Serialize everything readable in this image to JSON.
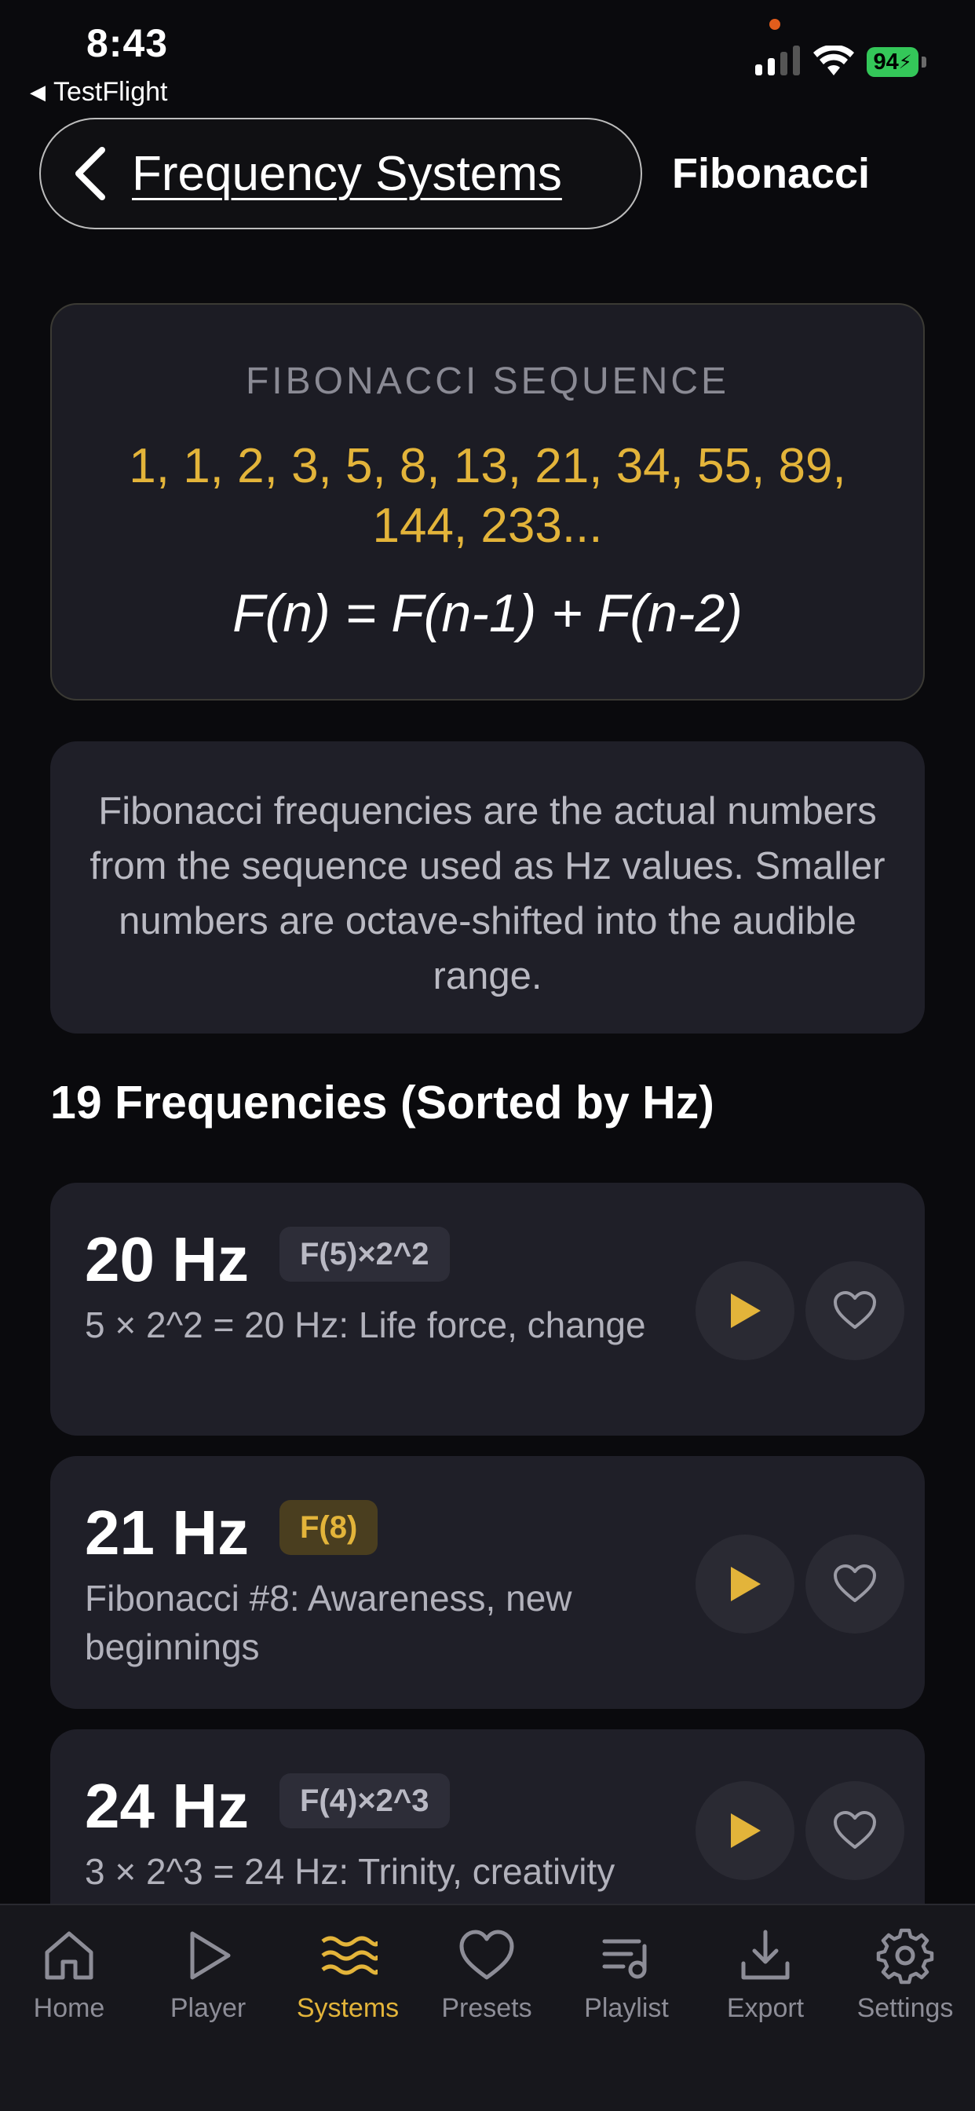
{
  "status_bar": {
    "time": "8:43",
    "back_app": "TestFlight",
    "battery": "94"
  },
  "nav": {
    "back_title": "Frequency Systems",
    "current_title": "Fibonacci"
  },
  "sequence_card": {
    "title": "FIBONACCI SEQUENCE",
    "values_line1": "1, 1, 2, 3, 5, 8, 13, 21, 34, 55, 89,",
    "values_line2": "144, 233...",
    "formula": "F(n) = F(n-1) + F(n-2)"
  },
  "description": "Fibonacci frequencies are the actual numbers from the sequence used as Hz values. Smaller numbers are octave-shifted into the audible range.",
  "section_heading": "19 Frequencies (Sorted by Hz)",
  "frequencies": [
    {
      "hz": "20 Hz",
      "badge": "F(5)×2^2",
      "badge_style": "grey",
      "desc": "5 × 2^2 = 20 Hz: Life force, change"
    },
    {
      "hz": "21 Hz",
      "badge": "F(8)",
      "badge_style": "gold",
      "desc": "Fibonacci #8: Awareness, new beginnings"
    },
    {
      "hz": "24 Hz",
      "badge": "F(4)×2^3",
      "badge_style": "grey",
      "desc": "3 × 2^3 = 24 Hz: Trinity, creativity"
    }
  ],
  "tabs": [
    {
      "label": "Home",
      "icon": "home-icon",
      "active": false
    },
    {
      "label": "Player",
      "icon": "play-icon",
      "active": false
    },
    {
      "label": "Systems",
      "icon": "waves-icon",
      "active": true
    },
    {
      "label": "Presets",
      "icon": "heart-icon",
      "active": false
    },
    {
      "label": "Playlist",
      "icon": "playlist-icon",
      "active": false
    },
    {
      "label": "Export",
      "icon": "download-icon",
      "active": false
    },
    {
      "label": "Settings",
      "icon": "gear-icon",
      "active": false
    }
  ],
  "colors": {
    "accent": "#e3b43a",
    "background": "#0a0a0d",
    "card": "#1f1f28"
  }
}
